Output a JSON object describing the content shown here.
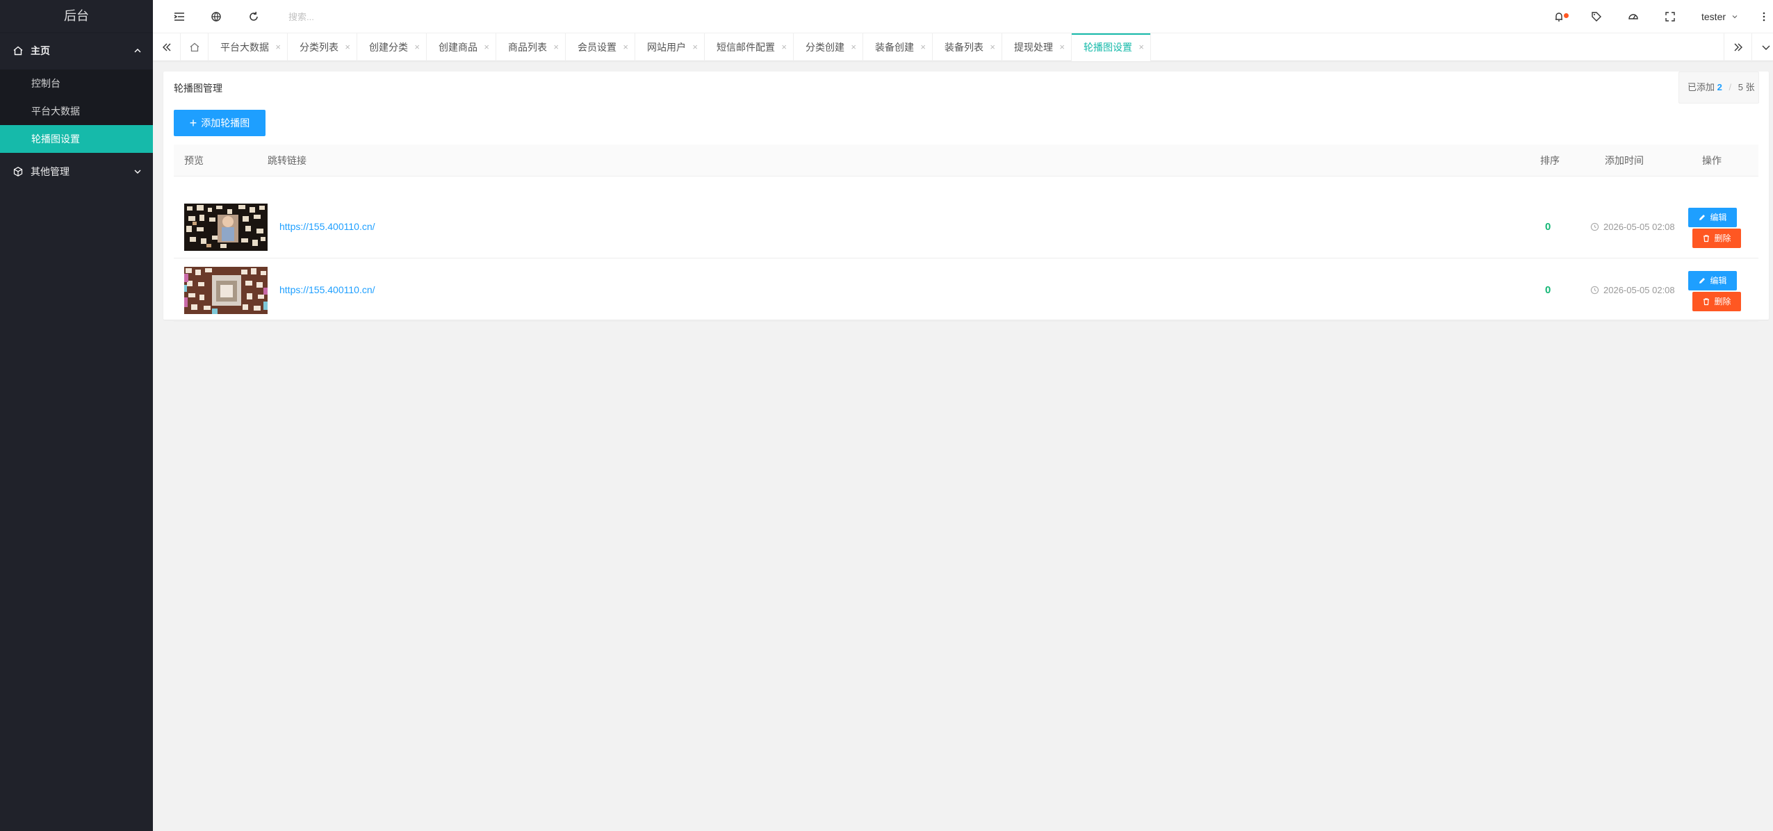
{
  "sidebar": {
    "logo": "后台",
    "groups": [
      {
        "label": "主页",
        "items": [
          "控制台",
          "平台大数据",
          "轮播图设置"
        ]
      },
      {
        "label": "其他管理"
      }
    ]
  },
  "header": {
    "search_placeholder": "搜索...",
    "user": "tester"
  },
  "tabs": [
    {
      "label": "平台大数据"
    },
    {
      "label": "分类列表"
    },
    {
      "label": "创建分类"
    },
    {
      "label": "创建商品"
    },
    {
      "label": "商品列表"
    },
    {
      "label": "会员设置"
    },
    {
      "label": "网站用户"
    },
    {
      "label": "短信邮件配置"
    },
    {
      "label": "分类创建"
    },
    {
      "label": "装备创建"
    },
    {
      "label": "装备列表"
    },
    {
      "label": "提现处理"
    },
    {
      "label": "轮播图设置"
    }
  ],
  "tab_close": "×",
  "card": {
    "title": "轮播图管理",
    "count_prefix": "已添加",
    "count_current": "2",
    "count_sep": "/",
    "count_total": "5 张",
    "add_button": "添加轮播图"
  },
  "table": {
    "headers": {
      "preview": "预览",
      "link": "跳转链接",
      "sort": "排序",
      "time": "添加时间",
      "actions": "操作"
    },
    "rows": [
      {
        "link": "https://155.400110.cn/",
        "sort": "0",
        "time": "2026-05-05 02:08",
        "edit": "编辑",
        "delete": "删除"
      },
      {
        "link": "https://155.400110.cn/",
        "sort": "0",
        "time": "2026-05-05 02:08",
        "edit": "编辑",
        "delete": "删除"
      }
    ]
  },
  "colors": {
    "sidebar_bg": "#20222a",
    "accent": "#16baaa",
    "primary": "#1e9fff",
    "danger": "#ff5722",
    "success": "#16b777"
  }
}
